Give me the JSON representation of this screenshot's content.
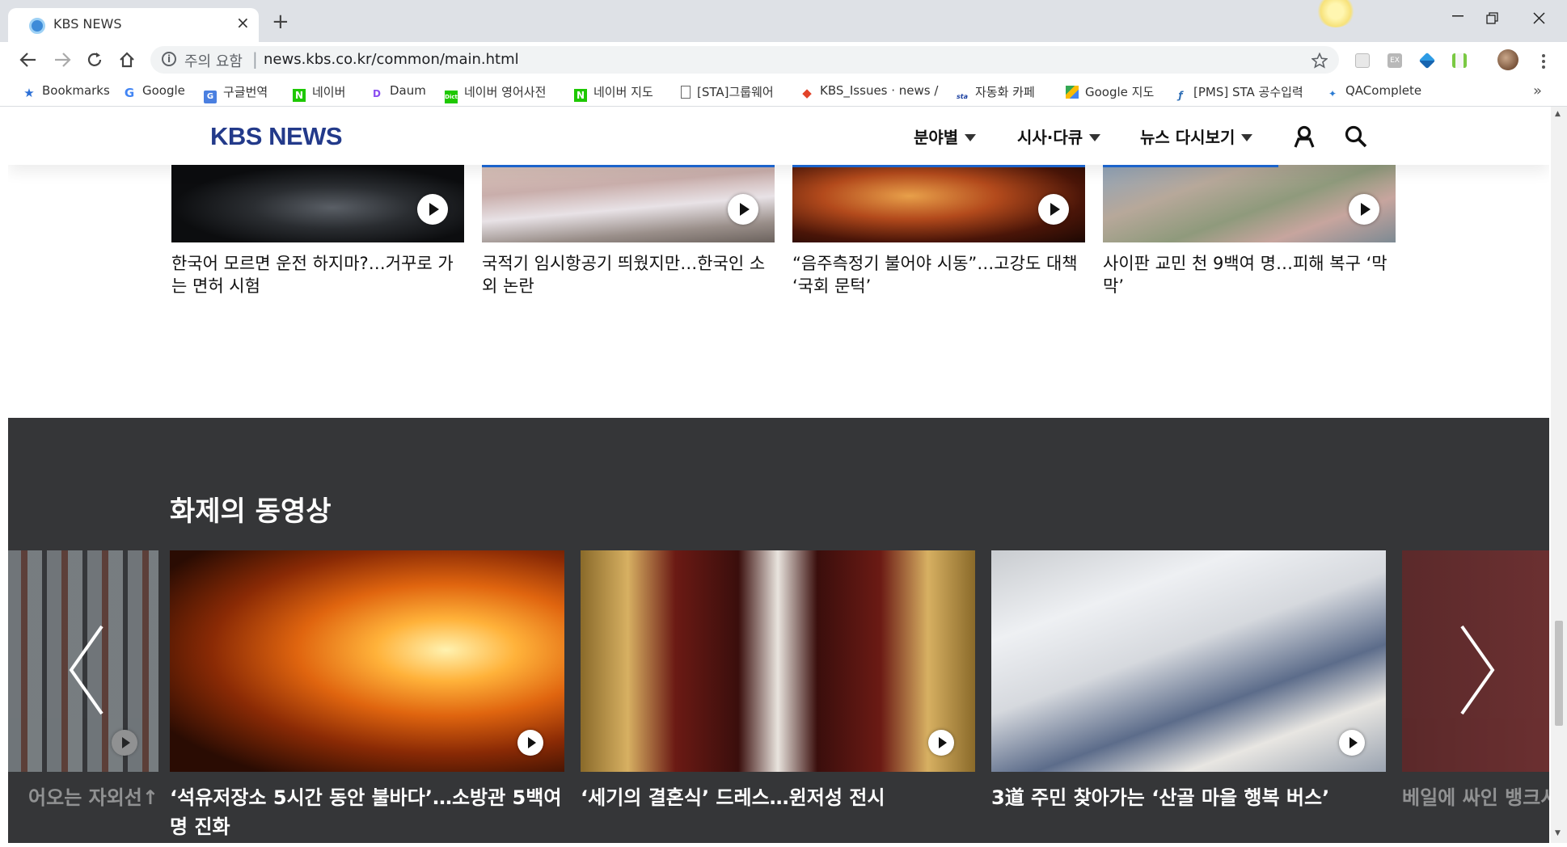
{
  "browser": {
    "tab_title": "KBS NEWS",
    "close_glyph": "×",
    "new_tab_glyph": "+",
    "url_warning": "주의 요함",
    "url_separator": "|",
    "url": "news.kbs.co.kr/common/main.html",
    "bookmarks": [
      {
        "label": "Bookmarks",
        "icon": "star-icon",
        "color": "#2b6fd6"
      },
      {
        "label": "Google",
        "icon": "google-icon",
        "color": "#4285f4"
      },
      {
        "label": "구글번역",
        "icon": "translate-icon",
        "color": "#4a7fe0"
      },
      {
        "label": "네이버",
        "icon": "naver-icon",
        "color": "#1ec800"
      },
      {
        "label": "Daum",
        "icon": "daum-icon",
        "color": "#8a4df0"
      },
      {
        "label": "네이버 영어사전",
        "icon": "dict-icon",
        "color": "#1ec800"
      },
      {
        "label": "네이버 지도",
        "icon": "naver-icon",
        "color": "#1ec800"
      },
      {
        "label": "[STA]그룹웨어",
        "icon": "page-icon",
        "color": "#666666"
      },
      {
        "label": "KBS_Issues · news / ",
        "icon": "gitlab-icon",
        "color": "#e24329"
      },
      {
        "label": "자동화 카페",
        "icon": "cafe-icon",
        "color": "#1a3fa0"
      },
      {
        "label": "Google 지도",
        "icon": "maps-icon",
        "color": "#34a853"
      },
      {
        "label": "[PMS] STA 공수입력",
        "icon": "pms-icon",
        "color": "#2f6fb5"
      },
      {
        "label": "QAComplete",
        "icon": "qa-icon",
        "color": "#2b7bd3"
      }
    ],
    "bookmarks_more": "»"
  },
  "site": {
    "logo": "KBS NEWS",
    "nav": [
      {
        "label": "분야별"
      },
      {
        "label": "시사·다큐"
      },
      {
        "label": "뉴스 다시보기"
      }
    ],
    "accent": "#1e6ad8",
    "logo_color": "#233a8a"
  },
  "news_cards": [
    {
      "title": "한국어 모르면 운전 하지마?…거꾸로 가는 면허 시험"
    },
    {
      "title": "국적기 임시항공기 띄웠지만…한국인 소외 논란"
    },
    {
      "title": "“음주측정기 불어야 시동”…고강도 대책 ‘국회 문턱’"
    },
    {
      "title": "사이판 교민 천 9백여 명…피해 복구 ‘막막’"
    }
  ],
  "trending": {
    "section_title": "화제의 동영상",
    "prev_partial_title": "어오는 자외선↑",
    "videos": [
      {
        "title": "‘석유저장소 5시간 동안 불바다’…소방관 5백여 명 진화"
      },
      {
        "title": "‘세기의 결혼식’ 드레스…윈저성 전시"
      },
      {
        "title": "3道 주민 찾아가는 ‘산골 마을 행복 버스’"
      }
    ],
    "next_partial_title": "베일에 싸인 뱅크시",
    "background": "#353638"
  }
}
